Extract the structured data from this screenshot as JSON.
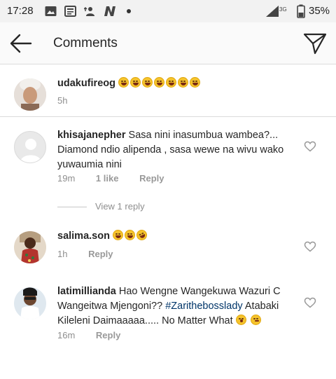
{
  "status_bar": {
    "time": "17:28",
    "network": "3G",
    "battery": "35%",
    "icons": [
      "gallery-icon",
      "news-icon",
      "person-upload-icon",
      "n-app-icon"
    ]
  },
  "header": {
    "title": "Comments"
  },
  "comments": [
    {
      "username": "udakufireog",
      "text": "",
      "emoji_count": 7,
      "time": "5h"
    },
    {
      "username": "khisajanepher",
      "text": "Sasa nini inasumbua wambea?... Diamond ndio alipenda , sasa wewe na wivu wako yuwaumia nini",
      "time": "19m",
      "likes": "1 like",
      "reply_label": "Reply",
      "view_replies": "View 1 reply"
    },
    {
      "username": "salima.son",
      "text": "",
      "time": "1h",
      "reply_label": "Reply"
    },
    {
      "username": "latimillianda",
      "text_before": "Hao Wengne Wangekuwa Wazuri C Wangeitwa Mjengoni?? ",
      "hashtag": "#Zarithebosslady",
      "text_after": " Atabaki Kileleni Daimaaaaa..... No Matter What ",
      "time": "16m",
      "reply_label": "Reply"
    }
  ],
  "colors": {
    "background": "#ffffff",
    "header_bg": "#fafafa",
    "status_bg": "#f2f2f2",
    "meta_grey": "#8e8e8e",
    "hashtag": "#003569"
  }
}
